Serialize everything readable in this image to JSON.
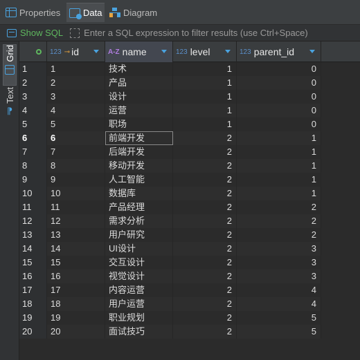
{
  "tabs": [
    {
      "label": "Properties",
      "icon": "grid-icon",
      "active": false
    },
    {
      "label": "Data",
      "icon": "data-table-icon",
      "active": true
    },
    {
      "label": "Diagram",
      "icon": "diagram-icon",
      "active": false
    }
  ],
  "filter": {
    "show_sql_label": "Show SQL",
    "placeholder": "Enter a SQL expression to filter results (use Ctrl+Space)"
  },
  "side_tabs": {
    "grid_label": "Grid",
    "text_label": "Text"
  },
  "columns": [
    {
      "type": "123",
      "key": true,
      "label": "id"
    },
    {
      "type": "A-Z",
      "key": false,
      "label": "name"
    },
    {
      "type": "123",
      "key": false,
      "label": "level"
    },
    {
      "type": "123",
      "key": false,
      "label": "parent_id"
    }
  ],
  "rows": [
    {
      "n": "1",
      "id": "1",
      "name": "技术",
      "level": "1",
      "parent_id": "0"
    },
    {
      "n": "2",
      "id": "2",
      "name": "产品",
      "level": "1",
      "parent_id": "0"
    },
    {
      "n": "3",
      "id": "3",
      "name": "设计",
      "level": "1",
      "parent_id": "0"
    },
    {
      "n": "4",
      "id": "4",
      "name": "运营",
      "level": "1",
      "parent_id": "0"
    },
    {
      "n": "5",
      "id": "5",
      "name": "职场",
      "level": "1",
      "parent_id": "0"
    },
    {
      "n": "6",
      "id": "6",
      "name": "前端开发",
      "level": "2",
      "parent_id": "1"
    },
    {
      "n": "7",
      "id": "7",
      "name": "后端开发",
      "level": "2",
      "parent_id": "1"
    },
    {
      "n": "8",
      "id": "8",
      "name": "移动开发",
      "level": "2",
      "parent_id": "1"
    },
    {
      "n": "9",
      "id": "9",
      "name": "人工智能",
      "level": "2",
      "parent_id": "1"
    },
    {
      "n": "10",
      "id": "10",
      "name": "数据库",
      "level": "2",
      "parent_id": "1"
    },
    {
      "n": "11",
      "id": "11",
      "name": "产品经理",
      "level": "2",
      "parent_id": "2"
    },
    {
      "n": "12",
      "id": "12",
      "name": "需求分析",
      "level": "2",
      "parent_id": "2"
    },
    {
      "n": "13",
      "id": "13",
      "name": "用户研究",
      "level": "2",
      "parent_id": "2"
    },
    {
      "n": "14",
      "id": "14",
      "name": "UI设计",
      "level": "2",
      "parent_id": "3"
    },
    {
      "n": "15",
      "id": "15",
      "name": "交互设计",
      "level": "2",
      "parent_id": "3"
    },
    {
      "n": "16",
      "id": "16",
      "name": "视觉设计",
      "level": "2",
      "parent_id": "3"
    },
    {
      "n": "17",
      "id": "17",
      "name": "内容运营",
      "level": "2",
      "parent_id": "4"
    },
    {
      "n": "18",
      "id": "18",
      "name": "用户运营",
      "level": "2",
      "parent_id": "4"
    },
    {
      "n": "19",
      "id": "19",
      "name": "职业规划",
      "level": "2",
      "parent_id": "5"
    },
    {
      "n": "20",
      "id": "20",
      "name": "面试技巧",
      "level": "2",
      "parent_id": "5"
    }
  ],
  "current_row": 6,
  "colors": {
    "accent": "#4aa3df",
    "show_sql": "#5fb85f",
    "key": "#e8a33d"
  }
}
